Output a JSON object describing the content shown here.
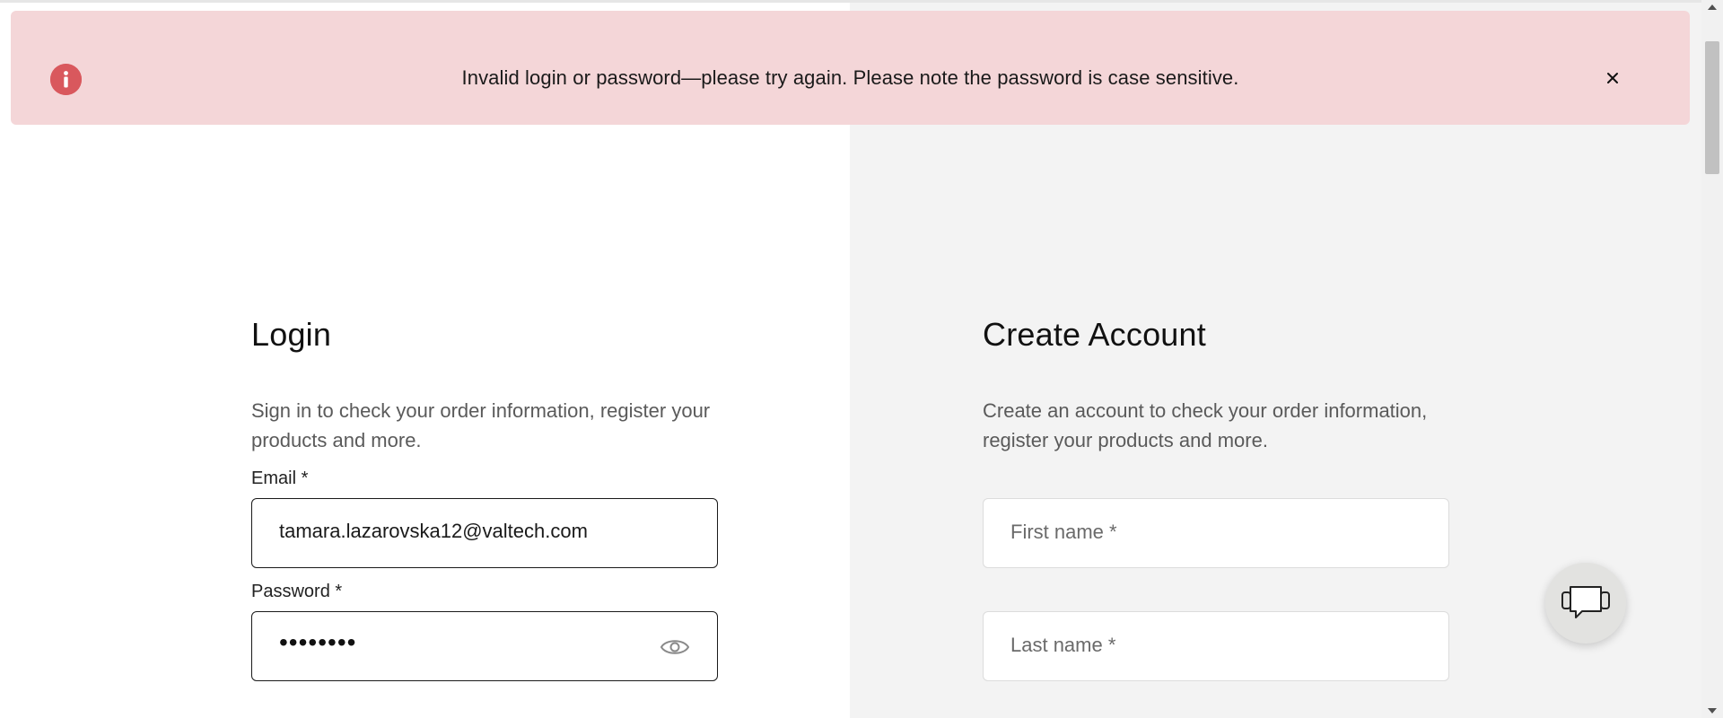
{
  "alert": {
    "icon": "info-icon",
    "message": "Invalid login or password—please try again. Please note the password is case sensitive.",
    "close_icon": "close-icon",
    "color": "#f4d6d8",
    "icon_color": "#d9585d"
  },
  "login": {
    "title": "Login",
    "description": "Sign in to check your order information, register your products and more.",
    "email_label": "Email *",
    "email_value": "tamara.lazarovska12@valtech.com",
    "password_label": "Password *",
    "password_value": "••••••••",
    "password_toggle_icon": "eye-icon"
  },
  "create_account": {
    "title": "Create Account",
    "description": "Create an account to check your order information, register your products and more.",
    "first_name_placeholder": "First name *",
    "last_name_placeholder": "Last name *",
    "background": "#f3f3f3"
  },
  "chat": {
    "icon": "chat-icon"
  }
}
